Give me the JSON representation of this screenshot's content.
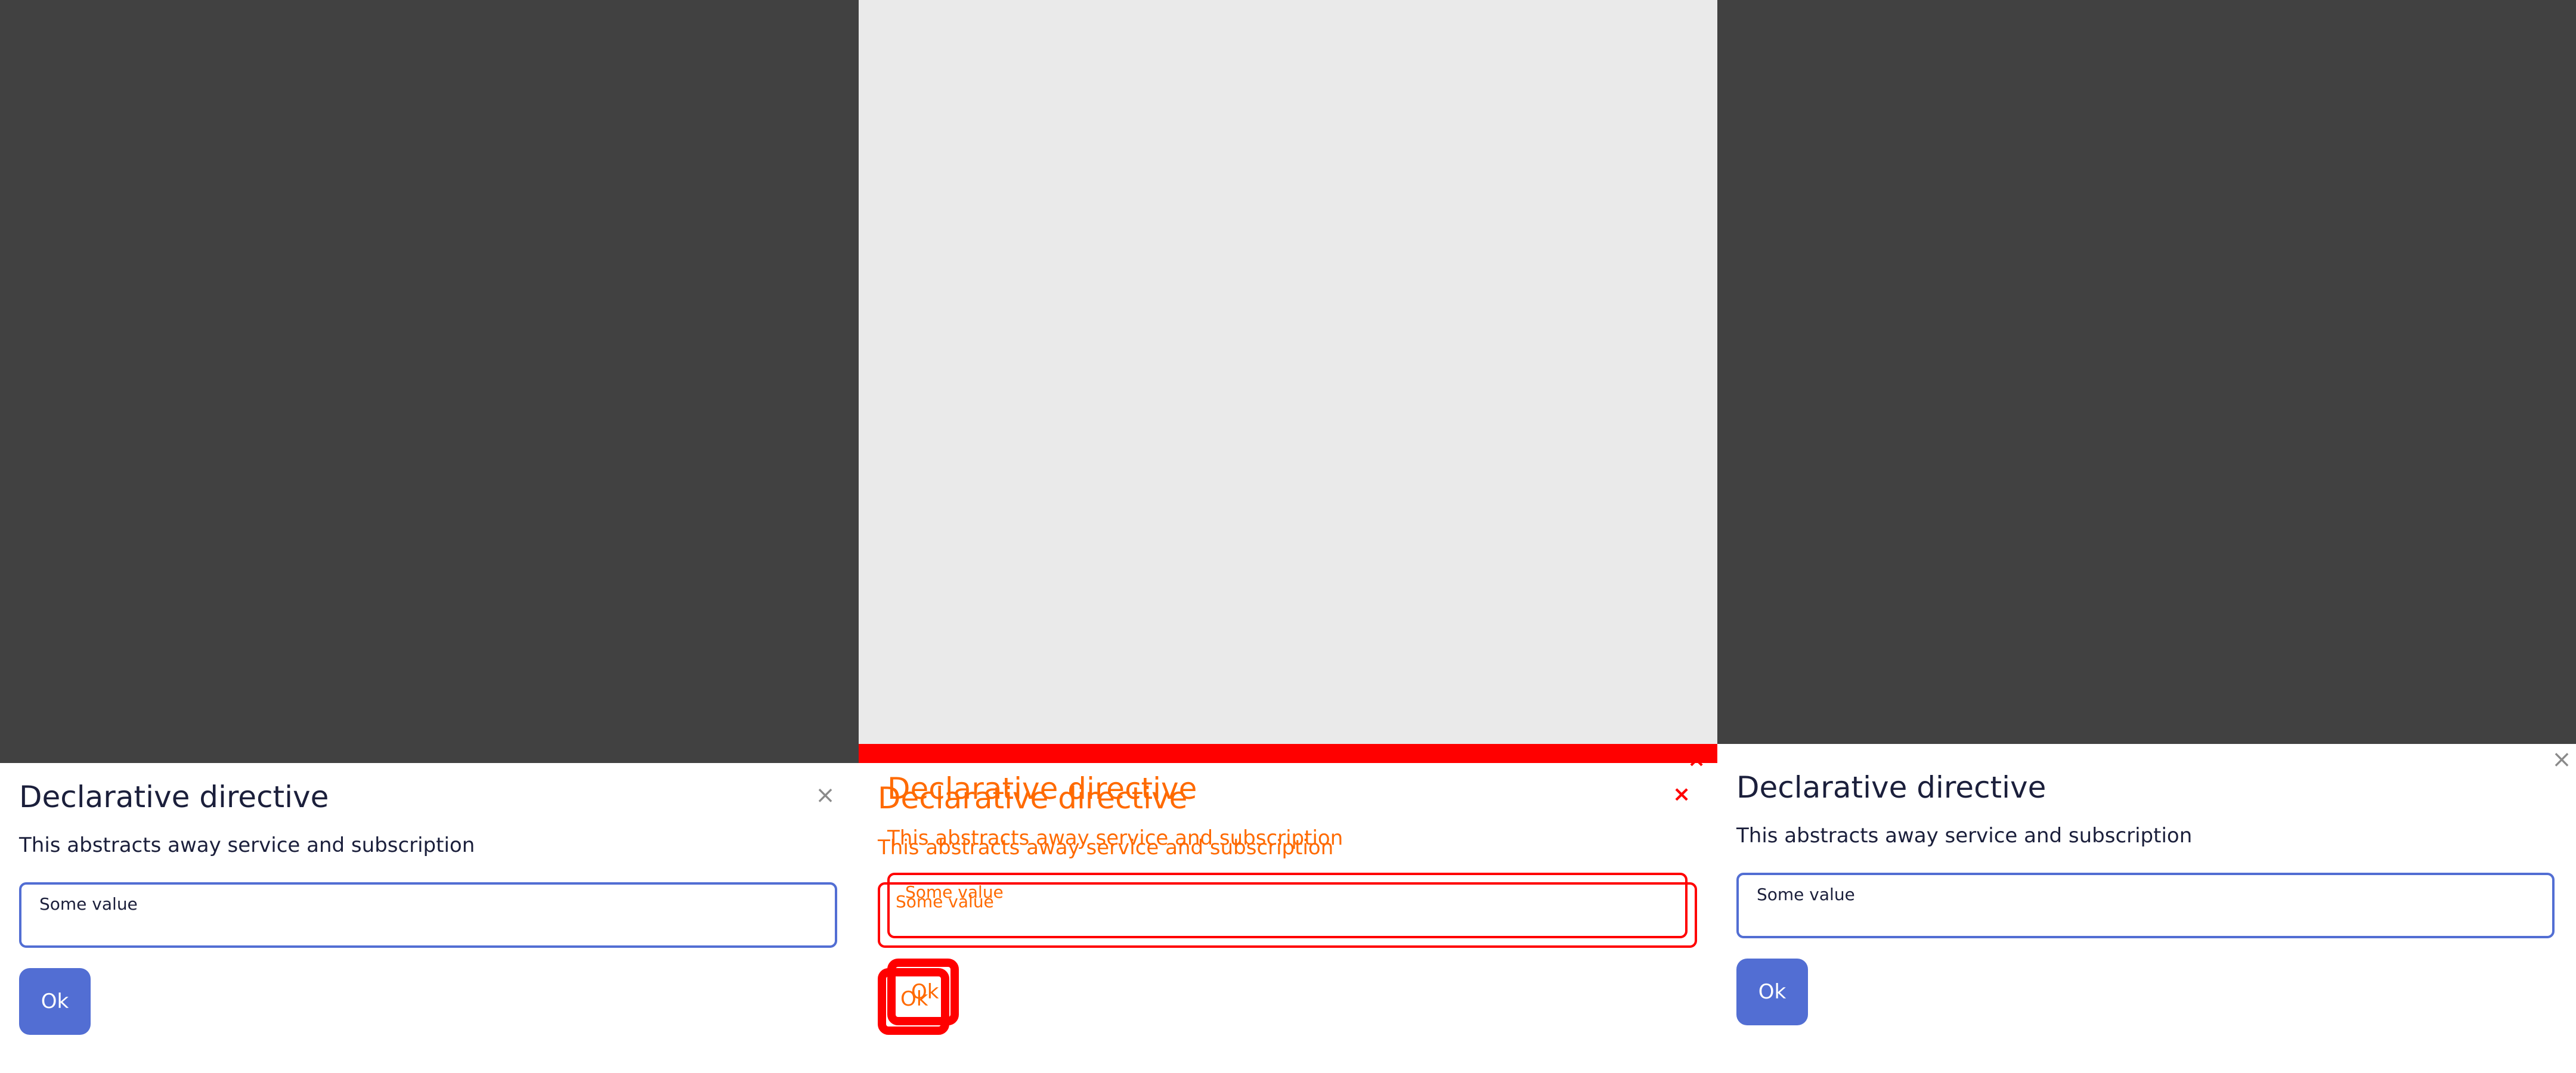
{
  "dialog": {
    "title": "Declarative directive",
    "subtitle": "This abstracts away service and subscription",
    "field_label": "Some value",
    "ok_label": "Ok",
    "close_icon": "×"
  },
  "colors": {
    "backdrop_dark": "#414141",
    "backdrop_light": "#eaeaea",
    "accent": "#526ed3",
    "debug_red": "#ff0000",
    "debug_orange": "#ff6a00"
  }
}
